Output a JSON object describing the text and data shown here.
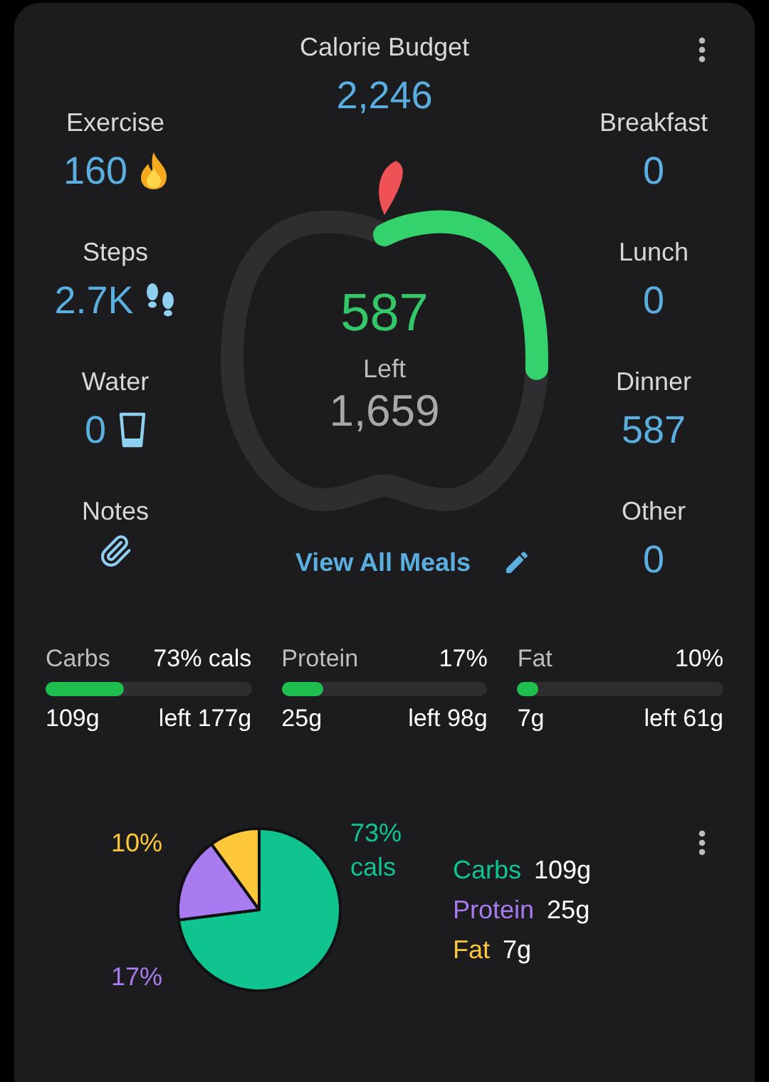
{
  "header": {
    "title": "Calorie Budget",
    "value": "2,246"
  },
  "left_stats": [
    {
      "kind": "value",
      "label": "Exercise",
      "value": "160"
    },
    {
      "kind": "value",
      "label": "Steps",
      "value": "2.7K"
    },
    {
      "kind": "value",
      "label": "Water",
      "value": "0"
    },
    {
      "kind": "attachment",
      "label": "Notes"
    }
  ],
  "right_stats": [
    {
      "label": "Breakfast",
      "value": "0"
    },
    {
      "label": "Lunch",
      "value": "0"
    },
    {
      "label": "Dinner",
      "value": "587"
    },
    {
      "label": "Other",
      "value": "0"
    }
  ],
  "ring": {
    "consumed": "587",
    "label": "Left",
    "remaining": "1,659"
  },
  "link": "View All Meals",
  "macros": [
    {
      "name": "Carbs",
      "percent": "73% cals",
      "amount": "109g",
      "left": "left 177g",
      "level": 0.38
    },
    {
      "name": "Protein",
      "percent": "17%",
      "amount": "25g",
      "left": "left 98g",
      "level": 0.2
    },
    {
      "name": "Fat",
      "percent": "10%",
      "amount": "7g",
      "left": "left 61g",
      "level": 0.1
    }
  ],
  "pie": {
    "chart_data": {
      "type": "pie",
      "categories": [
        "Carbs",
        "Protein",
        "Fat"
      ],
      "values": [
        73,
        17,
        10
      ],
      "value_labels": [
        "73% cals",
        "17%",
        "10%"
      ]
    },
    "legend": [
      {
        "amount": "109g",
        "color": "#10c48f"
      },
      {
        "amount": "25g",
        "color": "#a87cf0"
      },
      {
        "amount": "7g",
        "color": "#ffc83a"
      }
    ]
  }
}
